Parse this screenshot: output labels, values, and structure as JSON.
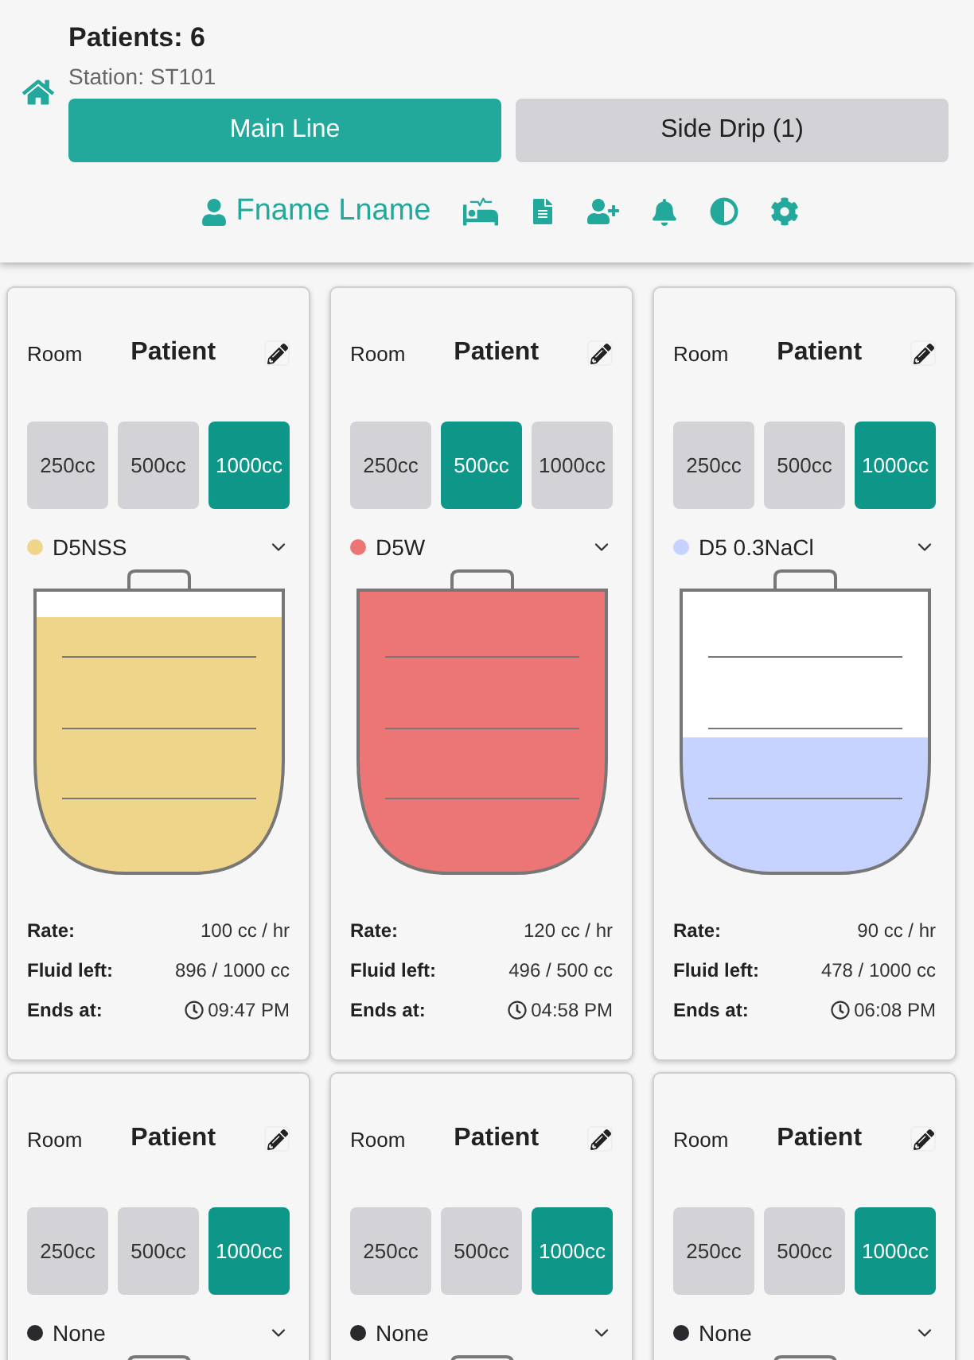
{
  "header": {
    "title": "Patients: 6",
    "station": "Station: ST101",
    "tabs": [
      {
        "label": "Main Line",
        "selected": true
      },
      {
        "label": "Side Drip (1)",
        "selected": false
      }
    ],
    "user": "Fname Lname"
  },
  "patients": [
    {
      "room": "Room",
      "name": "Patient",
      "volumes": [
        {
          "label": "250cc",
          "selected": false
        },
        {
          "label": "500cc",
          "selected": false
        },
        {
          "label": "1000cc",
          "selected": true
        }
      ],
      "fluid": {
        "name": "D5NSS",
        "color": "#efd58a"
      },
      "level": 0.9,
      "stats": [
        {
          "kind": "plain",
          "label": "Rate:",
          "value": "100 cc / hr"
        },
        {
          "kind": "plain",
          "label": "Fluid left:",
          "value": "896 / 1000 cc"
        },
        {
          "kind": "time",
          "label": "Ends at:",
          "value": "09:47 PM"
        }
      ]
    },
    {
      "room": "Room",
      "name": "Patient",
      "volumes": [
        {
          "label": "250cc",
          "selected": false
        },
        {
          "label": "500cc",
          "selected": true
        },
        {
          "label": "1000cc",
          "selected": false
        }
      ],
      "fluid": {
        "name": "D5W",
        "color": "#ec7676"
      },
      "level": 0.99,
      "stats": [
        {
          "kind": "plain",
          "label": "Rate:",
          "value": "120 cc / hr"
        },
        {
          "kind": "plain",
          "label": "Fluid left:",
          "value": "496 / 500 cc"
        },
        {
          "kind": "time",
          "label": "Ends at:",
          "value": "04:58 PM"
        }
      ]
    },
    {
      "room": "Room",
      "name": "Patient",
      "volumes": [
        {
          "label": "250cc",
          "selected": false
        },
        {
          "label": "500cc",
          "selected": false
        },
        {
          "label": "1000cc",
          "selected": true
        }
      ],
      "fluid": {
        "name": "D5 0.3NaCl",
        "color": "#c6d3fe"
      },
      "level": 0.48,
      "stats": [
        {
          "kind": "plain",
          "label": "Rate:",
          "value": "90 cc / hr"
        },
        {
          "kind": "plain",
          "label": "Fluid left:",
          "value": "478 / 1000 cc"
        },
        {
          "kind": "time",
          "label": "Ends at:",
          "value": "06:08 PM"
        }
      ]
    },
    {
      "room": "Room",
      "name": "Patient",
      "volumes": [
        {
          "label": "250cc",
          "selected": false
        },
        {
          "label": "500cc",
          "selected": false
        },
        {
          "label": "1000cc",
          "selected": true
        }
      ],
      "fluid": {
        "name": "None",
        "color": "#2a2a2e"
      }
    },
    {
      "room": "Room",
      "name": "Patient",
      "volumes": [
        {
          "label": "250cc",
          "selected": false
        },
        {
          "label": "500cc",
          "selected": false
        },
        {
          "label": "1000cc",
          "selected": true
        }
      ],
      "fluid": {
        "name": "None",
        "color": "#2a2a2e"
      }
    },
    {
      "room": "Room",
      "name": "Patient",
      "volumes": [
        {
          "label": "250cc",
          "selected": false
        },
        {
          "label": "500cc",
          "selected": false
        },
        {
          "label": "1000cc",
          "selected": true
        }
      ],
      "fluid": {
        "name": "None",
        "color": "#2a2a2e"
      }
    }
  ]
}
